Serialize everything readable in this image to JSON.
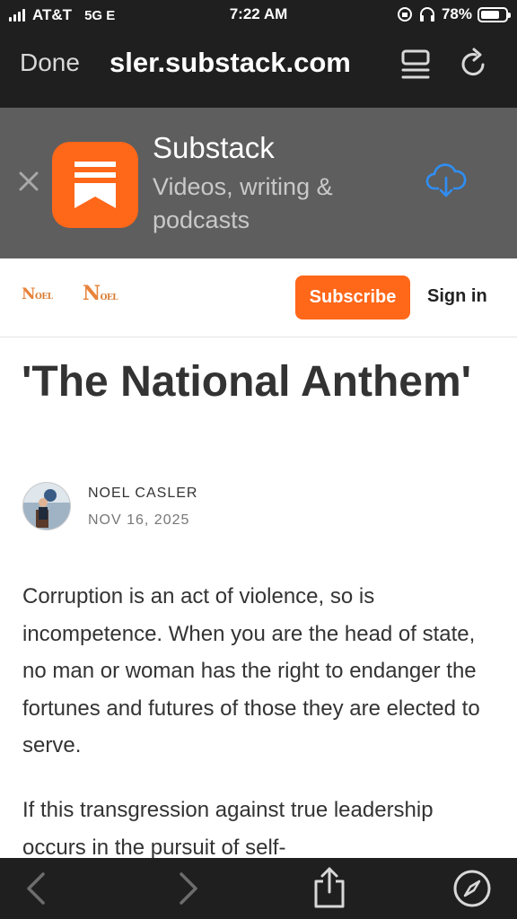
{
  "status_bar": {
    "carrier": "AT&T",
    "network": "5G E",
    "time": "7:22 AM",
    "battery_percent": "78%",
    "battery_level": 0.78
  },
  "browser": {
    "done_label": "Done",
    "url": "sler.substack.com",
    "back_enabled": false,
    "forward_enabled": false
  },
  "app_banner": {
    "app_name": "Substack",
    "subtitle": "Videos, writing & podcasts",
    "icon_color": "#ff6719",
    "accent_color": "#2f8ef5"
  },
  "site_header": {
    "logo_text": "NOEL CASLER",
    "subscribe_label": "Subscribe",
    "signin_label": "Sign in",
    "brand_color": "#ff6719"
  },
  "article": {
    "title": "'The National Anthem'",
    "author": "NOEL CASLER",
    "date": "NOV 16, 2025",
    "paragraphs": [
      "Corruption is an act of violence, so is incompetence. When you are the head of state, no man or woman has the right to endanger the fortunes and futures of those they are elected to serve.",
      "If this transgression against true leadership occurs in the pursuit of self-"
    ]
  }
}
